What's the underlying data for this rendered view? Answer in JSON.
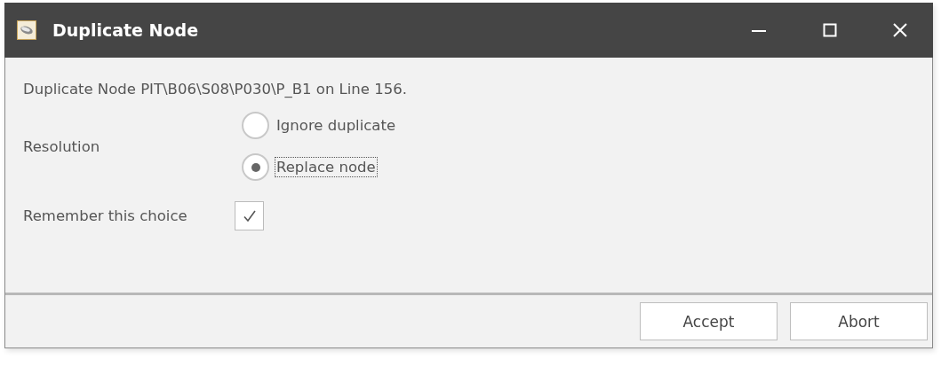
{
  "window": {
    "title": "Duplicate Node"
  },
  "message": "Duplicate Node PIT\\B06\\S08\\P030\\P_B1 on Line 156.",
  "resolution": {
    "label": "Resolution",
    "options": [
      {
        "label": "Ignore duplicate",
        "selected": false,
        "focused": false
      },
      {
        "label": "Replace node",
        "selected": true,
        "focused": true
      }
    ]
  },
  "remember": {
    "label": "Remember this choice",
    "checked": true
  },
  "buttons": [
    "Accept",
    "Abort"
  ]
}
